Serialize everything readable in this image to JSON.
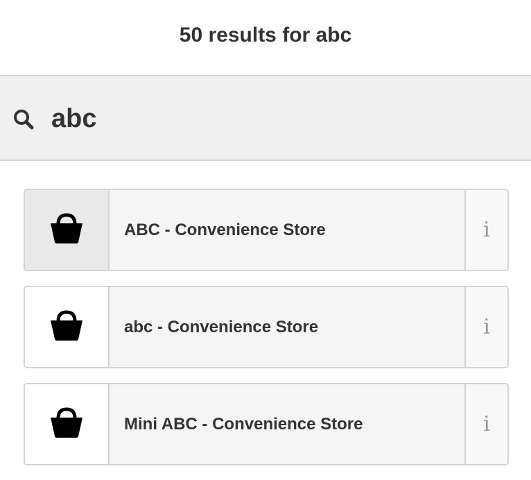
{
  "header": {
    "title": "50 results for abc"
  },
  "search": {
    "icon": "search-icon",
    "value": "abc"
  },
  "results": [
    {
      "icon": "basket-icon",
      "label": "ABC - Convenience Store",
      "info": "i",
      "active": true
    },
    {
      "icon": "basket-icon",
      "label": "abc - Convenience Store",
      "info": "i",
      "active": false
    },
    {
      "icon": "basket-icon",
      "label": "Mini ABC - Convenience Store",
      "info": "i",
      "active": false
    }
  ]
}
